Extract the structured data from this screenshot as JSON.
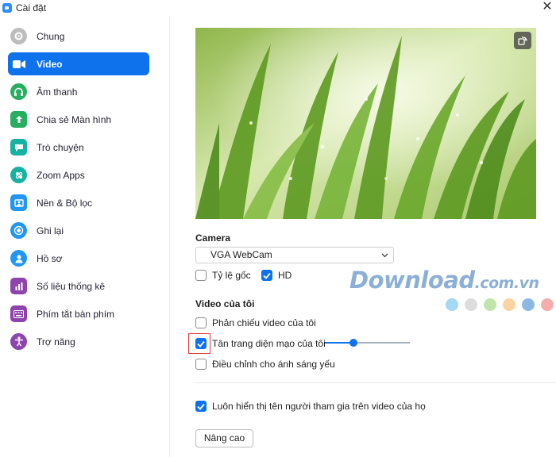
{
  "window": {
    "title": "Cài đặt",
    "close_glyph": "✕"
  },
  "sidebar": {
    "items": [
      {
        "label": "Chung",
        "icon": "gear-icon",
        "color": "#bdbdbd",
        "active": false
      },
      {
        "label": "Video",
        "icon": "video-camera-icon",
        "color": "#ffffff",
        "active": true
      },
      {
        "label": "Âm thanh",
        "icon": "headphones-icon",
        "color": "#27ae60",
        "active": false
      },
      {
        "label": "Chia sẻ Màn hình",
        "icon": "share-screen-icon",
        "color": "#27ae60",
        "active": false
      },
      {
        "label": "Trò chuyện",
        "icon": "chat-bubble-icon",
        "color": "#16b3a3",
        "active": false
      },
      {
        "label": "Zoom Apps",
        "icon": "apps-icon",
        "color": "#16b3a3",
        "active": false
      },
      {
        "label": "Nền & Bộ lọc",
        "icon": "background-filter-icon",
        "color": "#2196f3",
        "active": false
      },
      {
        "label": "Ghi lại",
        "icon": "record-icon",
        "color": "#2196f3",
        "active": false
      },
      {
        "label": "Hồ sơ",
        "icon": "profile-icon",
        "color": "#2196f3",
        "active": false
      },
      {
        "label": "Số liệu thống kê",
        "icon": "statistics-icon",
        "color": "#8e44ad",
        "active": false
      },
      {
        "label": "Phím tắt bàn phím",
        "icon": "keyboard-icon",
        "color": "#8e44ad",
        "active": false
      },
      {
        "label": "Trợ năng",
        "icon": "accessibility-icon",
        "color": "#8e44ad",
        "active": false
      }
    ]
  },
  "camera": {
    "label": "Camera",
    "selected": "VGA WebCam",
    "original_ratio": {
      "label": "Tỷ lệ gốc",
      "checked": false
    },
    "hd": {
      "label": "HD",
      "checked": true
    }
  },
  "my_video": {
    "label": "Video của tôi",
    "mirror": {
      "label": "Phản chiếu video của tôi",
      "checked": false
    },
    "touch_up": {
      "label": "Tân trang diện mạo của tôi",
      "checked": true,
      "level_percent": 34
    },
    "low_light": {
      "label": "Điều chỉnh cho ánh sáng yếu",
      "checked": false
    }
  },
  "always_show_names": {
    "label": "Luôn hiển thị tên người tham gia trên video của họ",
    "checked": true
  },
  "advanced_button": "Nâng cao",
  "watermark": {
    "brand": "Download",
    "suffix": ".com.vn",
    "dot_colors": [
      "#7ec8f0",
      "#cfcfcf",
      "#a6d98a",
      "#f7c27a",
      "#5a9bd8",
      "#f08a8a"
    ]
  },
  "colors": {
    "accent": "#0e72ed",
    "highlight": "#e23b3b"
  }
}
